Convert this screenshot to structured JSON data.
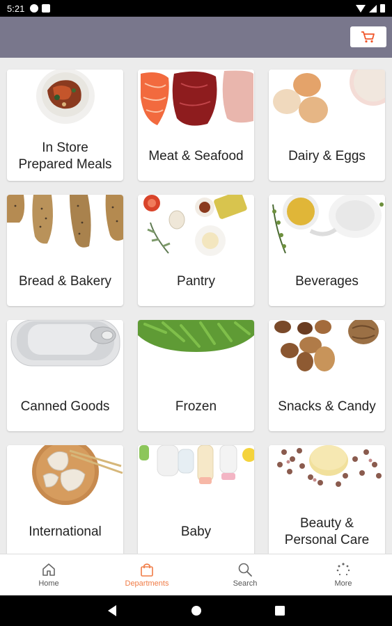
{
  "status_bar": {
    "time": "5:21"
  },
  "cart": {
    "icon": "cart-icon",
    "accent": "#f0552a"
  },
  "colors": {
    "app_bar": "#79778c",
    "active_tab": "#f07b45"
  },
  "departments": [
    {
      "label": "In Store\nPrepared Meals",
      "image": "prepared-meal-bowl"
    },
    {
      "label": "Meat & Seafood",
      "image": "salmon-steak-meat"
    },
    {
      "label": "Dairy & Eggs",
      "image": "eggs-milk"
    },
    {
      "label": "Bread & Bakery",
      "image": "baguettes"
    },
    {
      "label": "Pantry",
      "image": "spices-oil-tomatoes"
    },
    {
      "label": "Beverages",
      "image": "tea-teapot"
    },
    {
      "label": "Canned Goods",
      "image": "tin-can"
    },
    {
      "label": "Frozen",
      "image": "green-beans"
    },
    {
      "label": "Snacks & Candy",
      "image": "nuts"
    },
    {
      "label": "International",
      "image": "dumplings-chopsticks"
    },
    {
      "label": "Baby",
      "image": "baby-bottles-toys"
    },
    {
      "label": "Beauty &\nPersonal Care",
      "image": "soap-dried-roses"
    }
  ],
  "bottom_nav": [
    {
      "label": "Home",
      "icon": "home-icon",
      "active": false
    },
    {
      "label": "Departments",
      "icon": "shopping-bag-icon",
      "active": true
    },
    {
      "label": "Search",
      "icon": "search-icon",
      "active": false
    },
    {
      "label": "More",
      "icon": "more-dots-icon",
      "active": false
    }
  ]
}
